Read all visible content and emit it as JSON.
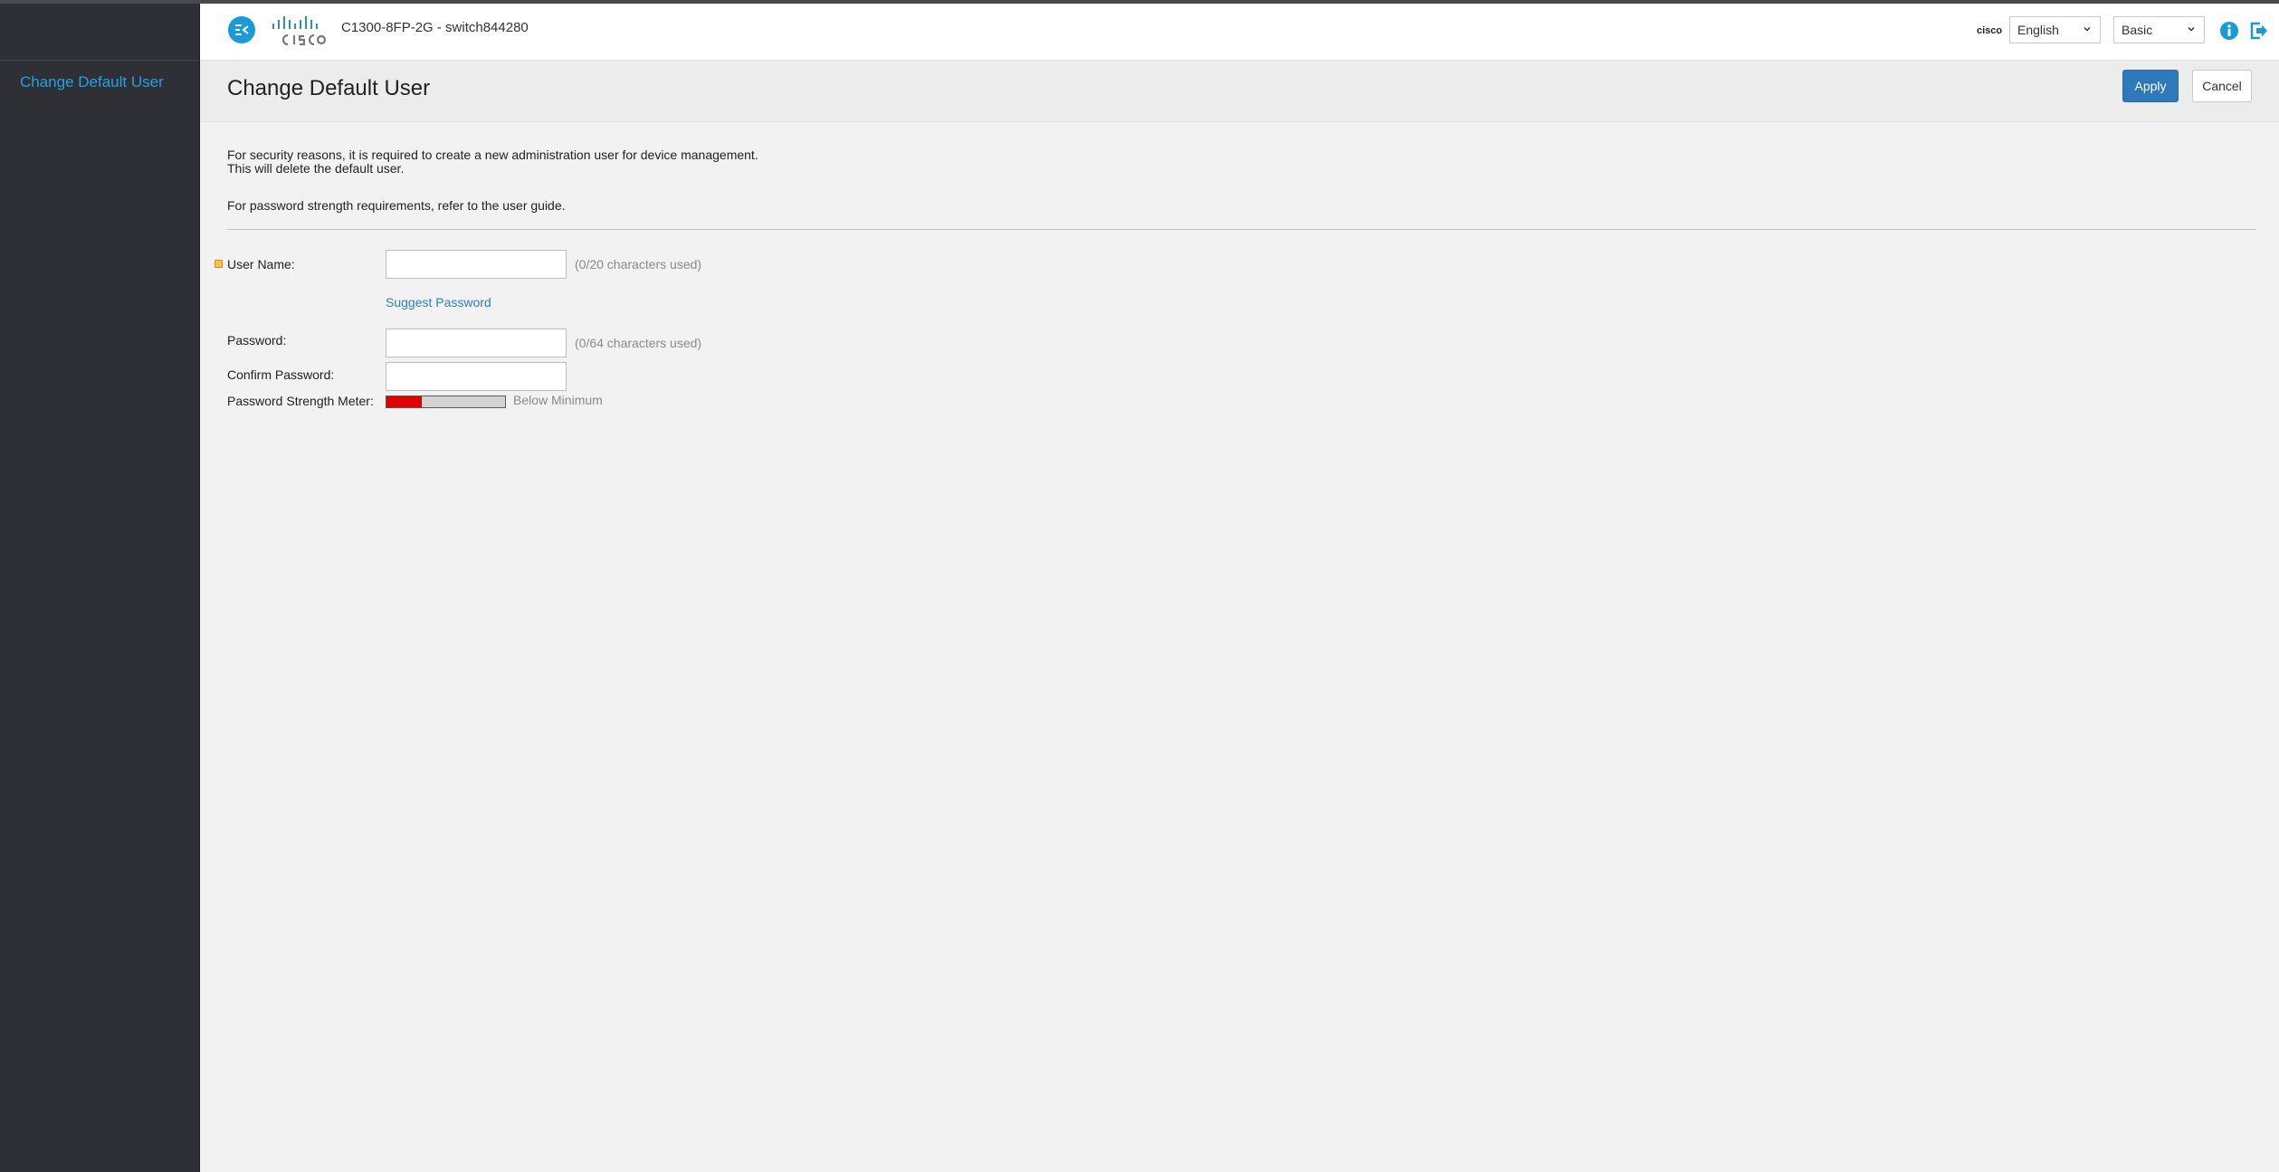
{
  "header": {
    "device_title": "C1300-8FP-2G - switch844280",
    "mini_logo": "cisco",
    "language": "English",
    "mode": "Basic"
  },
  "sidebar": {
    "items": [
      {
        "label": "Change Default User"
      }
    ]
  },
  "page": {
    "title": "Change Default User",
    "apply_label": "Apply",
    "cancel_label": "Cancel"
  },
  "notes": {
    "line1": "For security reasons, it is required to create a new administration user for device management.",
    "line2": "This will delete the default user.",
    "line3": "For password strength requirements, refer to the user guide."
  },
  "form": {
    "username_label": "User Name:",
    "username_value": "",
    "username_hint": "(0/20 characters used)",
    "suggest_password": "Suggest Password",
    "password_label": "Password:",
    "password_value": "",
    "password_hint": "(0/64 characters used)",
    "confirm_label": "Confirm Password:",
    "confirm_value": "",
    "meter_label": "Password Strength Meter:",
    "meter_level_fraction": 0.3,
    "meter_text": "Below Minimum"
  },
  "colors": {
    "accent": "#1a9ad6",
    "apply_button": "#2e79b9",
    "sidebar_bg": "#2f3035",
    "sidebar_link": "#1fa3e0",
    "meter_fill": "#e00000",
    "required_marker": "#f9c14e"
  },
  "icons": {
    "menu_toggle": "menu-toggle-icon",
    "info": "info-icon",
    "logout": "logout-icon",
    "cisco_logo": "cisco-logo-icon"
  }
}
